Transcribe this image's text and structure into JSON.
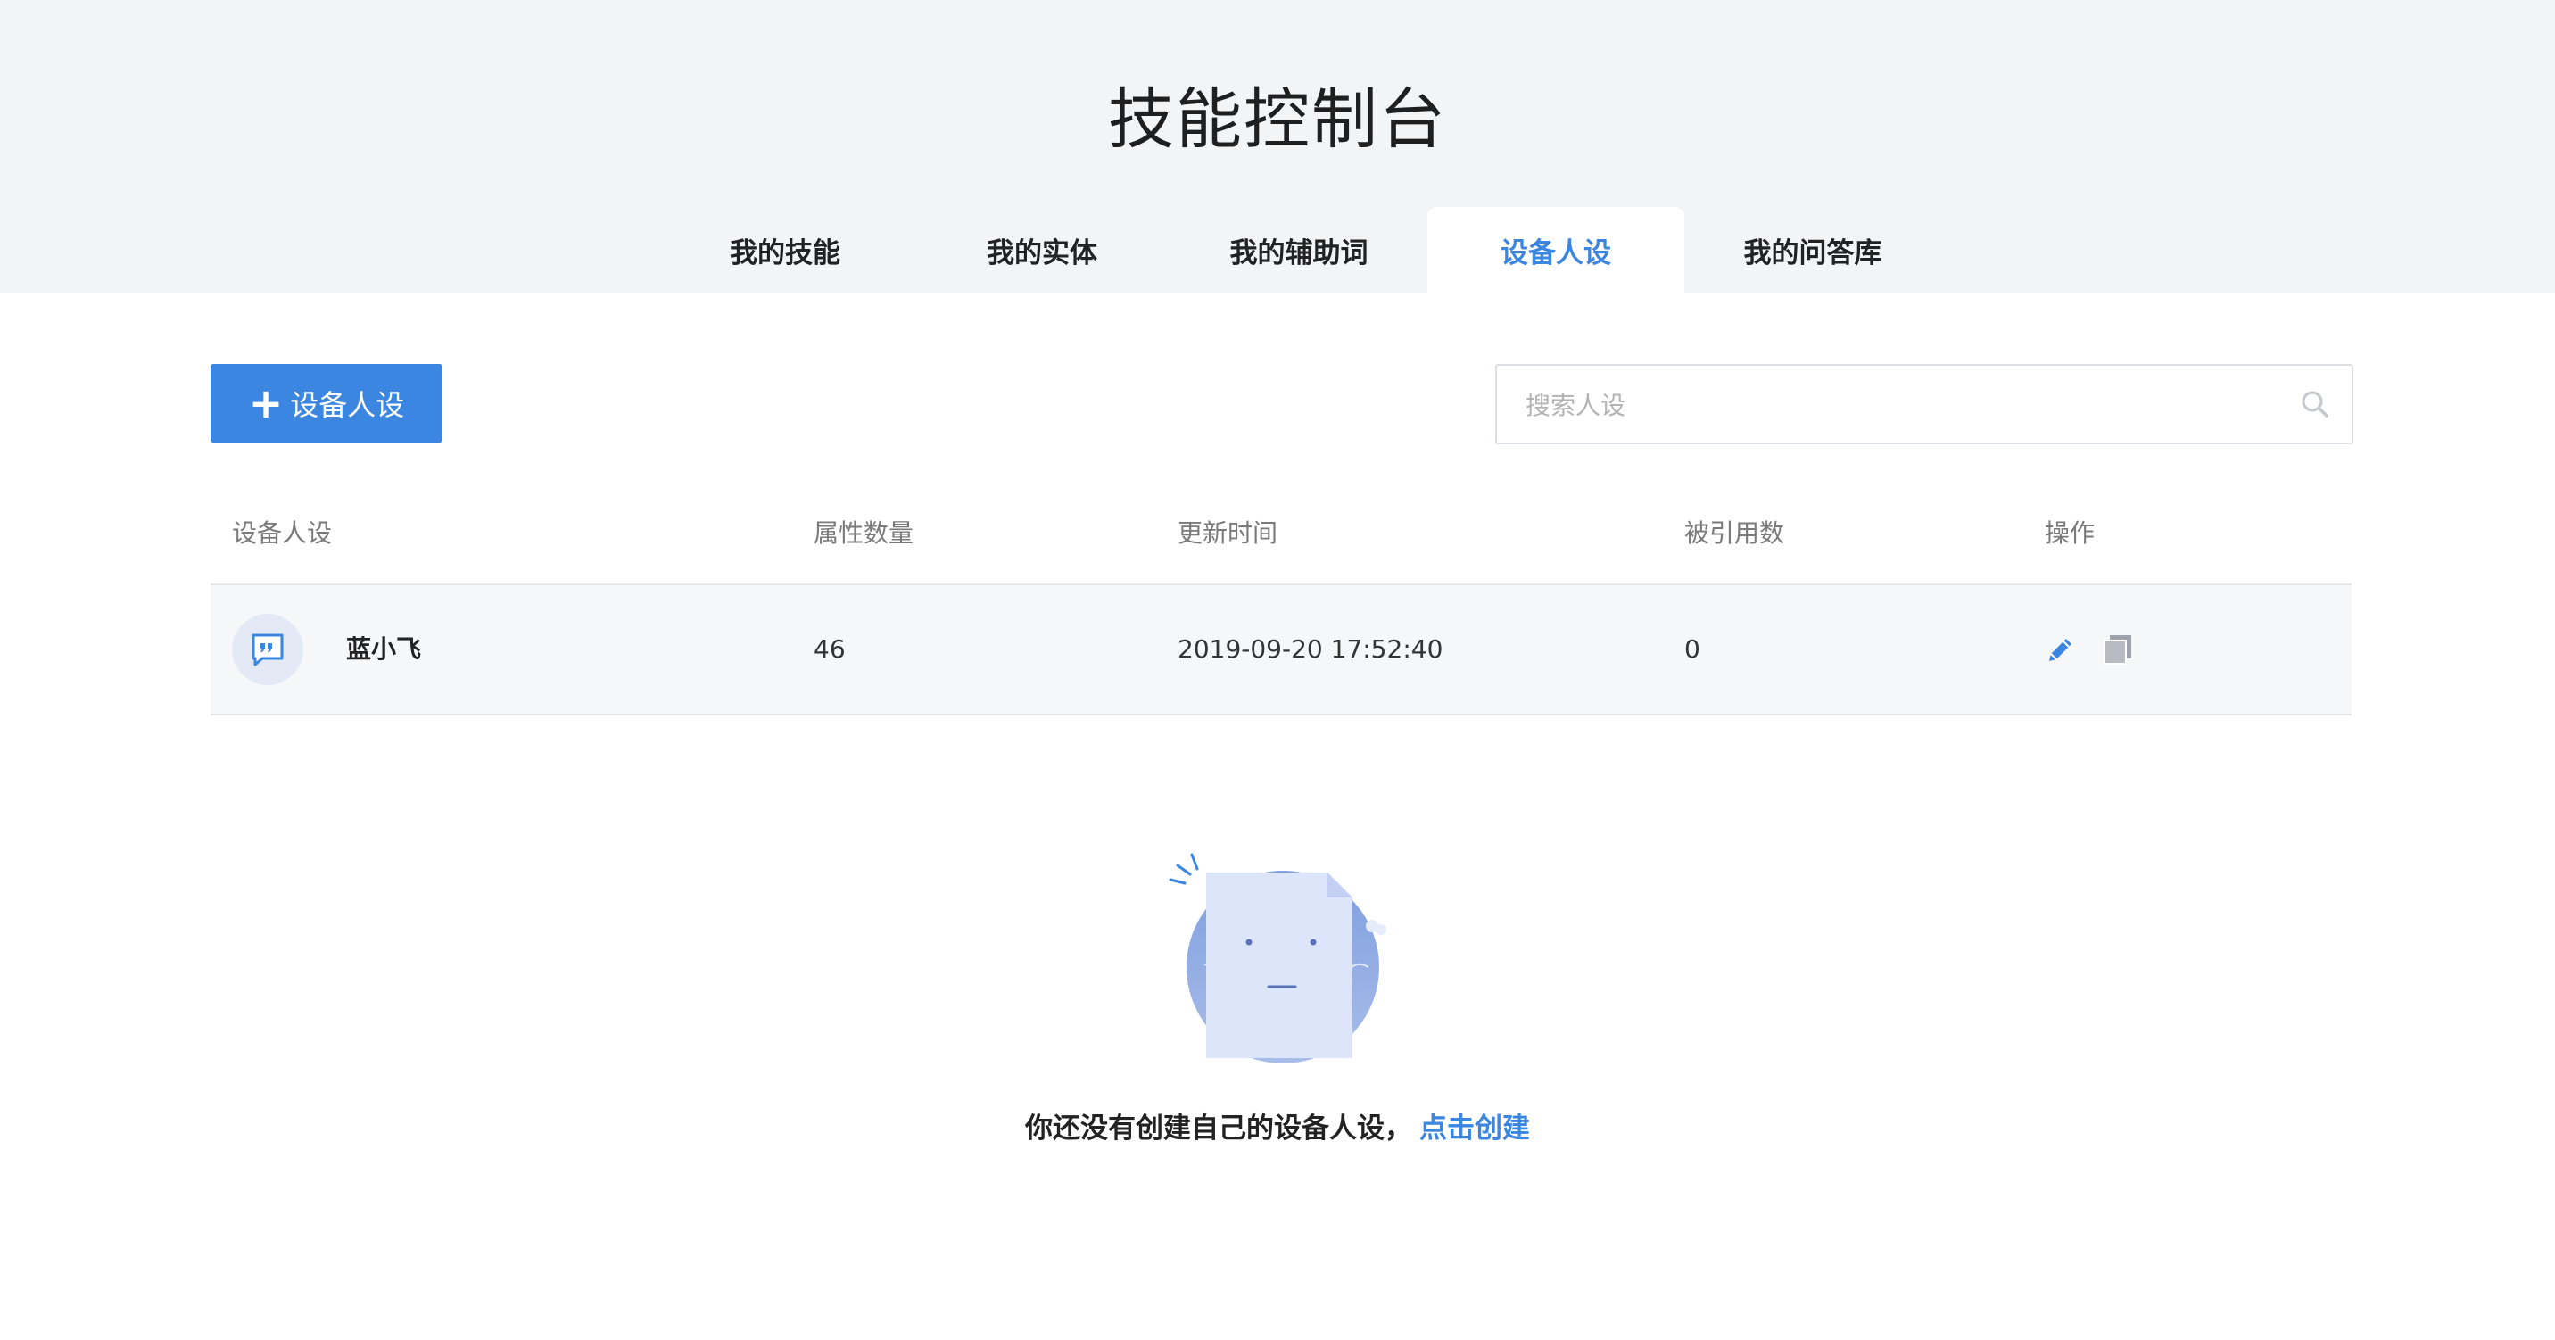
{
  "header": {
    "title": "技能控制台"
  },
  "tabs": [
    {
      "label": "我的技能",
      "active": false
    },
    {
      "label": "我的实体",
      "active": false
    },
    {
      "label": "我的辅助词",
      "active": false
    },
    {
      "label": "设备人设",
      "active": true
    },
    {
      "label": "我的问答库",
      "active": false
    }
  ],
  "toolbar": {
    "add_button_label": "设备人设",
    "add_icon": "plus-icon",
    "search_placeholder": "搜索人设",
    "search_icon": "search-icon"
  },
  "table": {
    "columns": [
      "设备人设",
      "属性数量",
      "更新时间",
      "被引用数",
      "操作"
    ],
    "rows": [
      {
        "avatar_icon": "quote-card-icon",
        "name": "蓝小飞",
        "attribute_count": "46",
        "updated_at": "2019-09-20 17:52:40",
        "reference_count": "0",
        "actions": [
          "edit-icon",
          "copy-icon"
        ]
      }
    ]
  },
  "empty_state": {
    "illustration": "empty-document-face",
    "message": "你还没有创建自己的设备人设，",
    "link_label": "点击创建"
  },
  "colors": {
    "accent": "#3b86e0",
    "header_bg": "#f3f4f6",
    "row_bg": "#f6f7f9"
  }
}
